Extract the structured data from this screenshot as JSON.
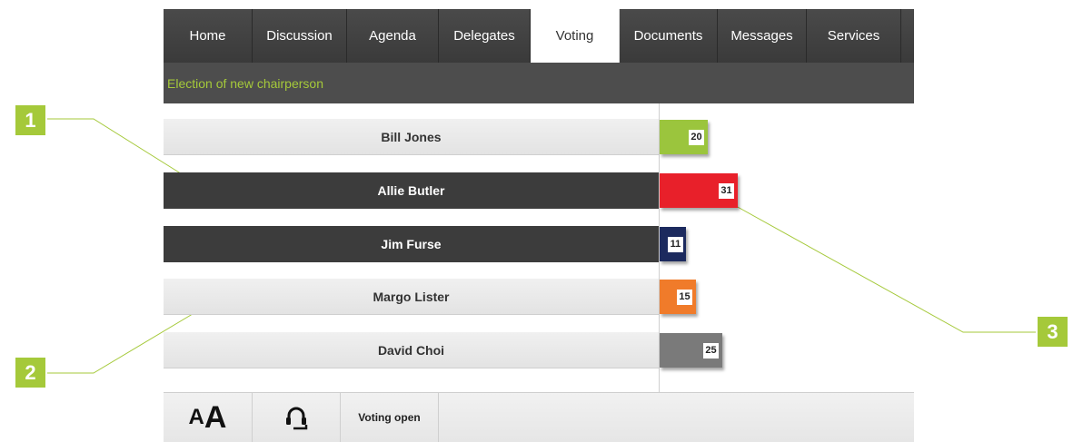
{
  "nav": {
    "tabs": [
      {
        "label": "Home"
      },
      {
        "label": "Discussion"
      },
      {
        "label": "Agenda"
      },
      {
        "label": "Delegates"
      },
      {
        "label": "Voting",
        "active": true
      },
      {
        "label": "Documents"
      },
      {
        "label": "Messages"
      },
      {
        "label": "Services"
      }
    ]
  },
  "subheader": {
    "title": "Election of new chairperson"
  },
  "candidates": [
    {
      "name": "Bill Jones",
      "votes": "20",
      "color": "#9bc53d",
      "style": "light"
    },
    {
      "name": "Allie Butler",
      "votes": "31",
      "color": "#e8202a",
      "style": "dark"
    },
    {
      "name": "Jim Furse",
      "votes": "11",
      "color": "#1c2a5e",
      "style": "dark"
    },
    {
      "name": "Margo Lister",
      "votes": "15",
      "color": "#f07b2a",
      "style": "light"
    },
    {
      "name": "David Choi",
      "votes": "25",
      "color": "#7a7a7a",
      "style": "light"
    }
  ],
  "footer": {
    "font_small": "A",
    "font_large": "A",
    "status": "Voting open"
  },
  "callouts": {
    "c1": "1",
    "c2": "2",
    "c3": "3"
  },
  "accent": "#a5c93a"
}
